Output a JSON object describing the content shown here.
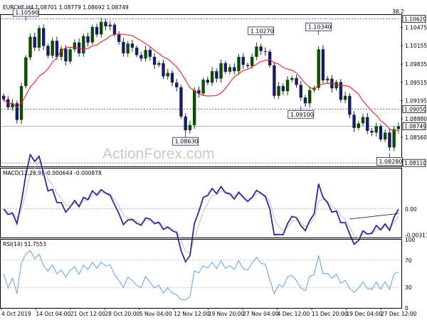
{
  "chart_data": [
    {
      "type": "candlestick",
      "title": "EURCHF,H4  1.08701 1.08779 1.08692 1.08749",
      "watermark": "ActionForex.com",
      "ylim": [
        1.0805,
        1.1069
      ],
      "y_ticks": [
        "1.10475",
        "1.10155",
        "1.09835",
        "1.09515",
        "1.09195",
        "1.08880",
        "1.08560"
      ],
      "y_tick_values": [
        1.10475,
        1.10155,
        1.09835,
        1.09515,
        1.09195,
        1.0888,
        1.0856
      ],
      "price_tags": [
        {
          "text": "1.10620",
          "value": 1.1062
        },
        {
          "text": "1.09050",
          "value": 1.0905
        },
        {
          "text": "1.08749",
          "value": 1.08749
        },
        {
          "text": "1.08110",
          "value": 1.0811
        }
      ],
      "fib_label": "38.2",
      "horizontal_levels": [
        1.1062,
        1.0905,
        1.08749,
        1.0811
      ],
      "level_colors": {
        "1.10620": "#555555",
        "1.09050": "#555555",
        "1.08749": "#999999",
        "1.08110": "#555555"
      },
      "annotations": [
        {
          "text": "1.10590",
          "x_index": 5,
          "value": 1.1059
        },
        {
          "text": "1.10270",
          "x_index": 58,
          "value": 1.1027
        },
        {
          "text": "1.10340",
          "x_index": 71,
          "value": 1.1034
        },
        {
          "text": "1.08630",
          "x_index": 41,
          "value": 1.0863
        },
        {
          "text": "1.09100",
          "x_index": 67,
          "value": 1.091
        },
        {
          "text": "1.08280",
          "x_index": 87,
          "value": 1.0828
        }
      ],
      "x_labels": [
        "4 Oct 2019",
        "14 Oct 04:00",
        "21 Oct 12:00",
        "28 Oct 20:00",
        "5 Nov 04:00",
        "12 Nov 12:00",
        "19 Nov 20:00",
        "27 Nov 04:00",
        "4 Dec 12:00",
        "11 Dec 20:00",
        "19 Dec 04:00",
        "27 Dec 12:00"
      ],
      "close": [
        1.0922,
        1.0908,
        1.0915,
        1.0886,
        1.0945,
        1.0995,
        1.1031,
        1.1012,
        1.1046,
        1.1015,
        1.0998,
        1.1024,
        1.0996,
        1.101,
        1.0988,
        1.1009,
        1.1021,
        1.1002,
        1.1032,
        1.1021,
        1.1048,
        1.1035,
        1.1057,
        1.1049,
        1.1052,
        1.1035,
        1.1022,
        1.1002,
        1.1019,
        1.1012,
        1.0999,
        1.0993,
        1.1008,
        1.0996,
        1.0982,
        1.0985,
        1.0962,
        1.0968,
        1.0951,
        1.0943,
        1.0892,
        1.0868,
        1.0877,
        1.0938,
        1.0932,
        1.0956,
        1.0951,
        1.0971,
        1.0958,
        1.0985,
        1.097,
        1.0978,
        1.0971,
        1.0996,
        1.0982,
        1.098,
        1.0996,
        1.1014,
        1.1006,
        1.1005,
        1.0981,
        1.0928,
        1.0945,
        1.0936,
        1.0956,
        1.0959,
        1.0947,
        1.0925,
        1.0915,
        1.0938,
        1.0942,
        1.1009,
        1.0955,
        1.0958,
        1.0941,
        1.0952,
        1.0921,
        1.0928,
        1.0895,
        1.0872,
        1.088,
        1.0891,
        1.0867,
        1.0864,
        1.0875,
        1.0852,
        1.0864,
        1.0838,
        1.087,
        1.0875
      ]
    },
    {
      "type": "line",
      "title": "MACD(12,26,9) -0.000644 -0.000878",
      "ylim": [
        -0.0034,
        0.0048
      ],
      "y_ticks": [
        "0.00",
        "-0.003119"
      ],
      "y_tick_values": [
        0.0,
        -0.003119
      ],
      "trendline": [
        {
          "x_index": 78,
          "value": -0.0012
        },
        {
          "x_index": 89,
          "value": -0.00055
        }
      ]
    },
    {
      "type": "line",
      "title": "RSI(14) 51.7553",
      "ylim": [
        0,
        100
      ],
      "y_ticks": [
        "100",
        "70",
        "30",
        "0"
      ],
      "y_tick_values": [
        100,
        70,
        30,
        0
      ],
      "levels": [
        70,
        30
      ]
    }
  ],
  "colors": {
    "up": "#0a4d00",
    "down": "#1a1a66",
    "ma": "#ee2222",
    "macd": "#2a2aa0",
    "signal": "#c0c0c0",
    "rsi": "#5fa0e6",
    "text": "#000000"
  }
}
